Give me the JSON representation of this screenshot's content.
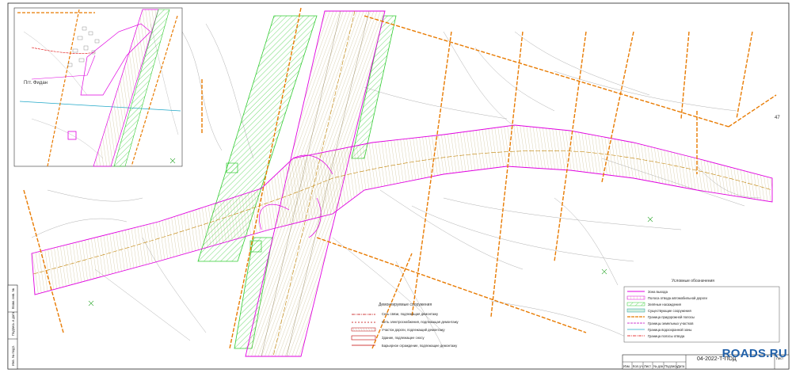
{
  "watermark": "ROADS.RU",
  "drawing_code": "04-2022-Т-ПОД",
  "sheet_field_label": "Лист",
  "sheet_number": "47",
  "title_block_columns": [
    "Изм.",
    "Кол.уч",
    "Лист",
    "№ док.",
    "Подпись",
    "Дата"
  ],
  "side_stamp_labels": [
    "Инв. № подл.",
    "Подпись и дата",
    "Взам. инв. №"
  ],
  "place_label": "Пгт. Фидан",
  "colors": {
    "road_outline": "#e000e0",
    "utility": "#e87a00",
    "greenery": "#33cc33",
    "red_line": "#e00000",
    "hatch": "#b0a070",
    "relief": "#a8a8a8",
    "water": "#20a8c8",
    "frame": "#222222",
    "watermark": "#1f5fa8"
  },
  "legend_left": {
    "title": "Демонтируемые сооружения",
    "items": [
      "Сеть связи, подлежащая демонтажу",
      "Сеть электроснабжения, подлежащая демонтажу",
      "Участок дороги, подлежащий демонтажу",
      "Здание, подлежащее сносу",
      "Барьерное ограждение, подлежащее демонтажу"
    ]
  },
  "legend_right": {
    "title": "Условные обозначения",
    "items": [
      "Зона выхода",
      "Полоса отвода автомобильной дороги",
      "Зелёные насаждения",
      "Существующие сооружения",
      "Граница придорожной полосы",
      "Границы земельных участков",
      "Граница водоохранной зоны",
      "Граница полосы отвода"
    ]
  }
}
